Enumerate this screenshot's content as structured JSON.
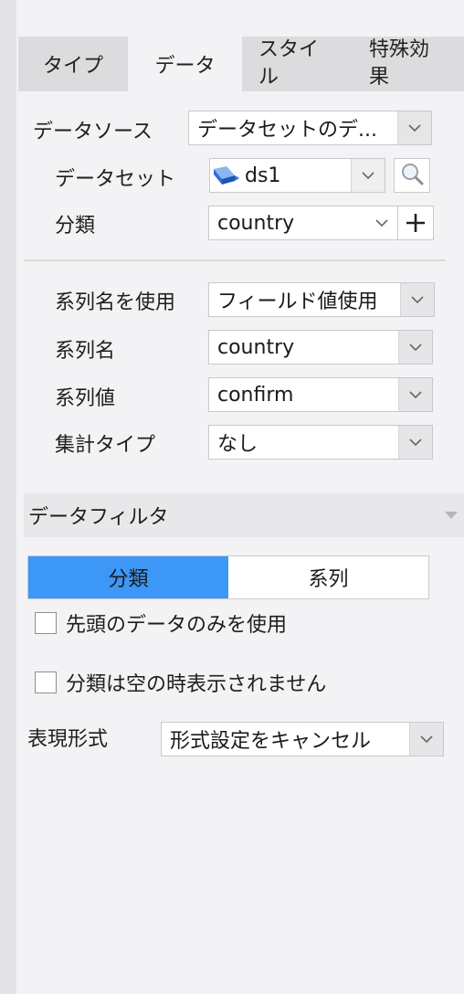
{
  "tabs": [
    {
      "label": "タイプ",
      "active": false
    },
    {
      "label": "データ",
      "active": true
    },
    {
      "label": "スタイル",
      "active": false
    },
    {
      "label": "特殊効果",
      "active": false
    }
  ],
  "datasource": {
    "label": "データソース",
    "value": "データセットのデ..."
  },
  "dataset": {
    "label": "データセット",
    "value": "ds1"
  },
  "category": {
    "label": "分類",
    "value": "country"
  },
  "series_name_mode": {
    "label": "系列名を使用",
    "value": "フィールド値使用"
  },
  "series_name": {
    "label": "系列名",
    "value": "country"
  },
  "series_value": {
    "label": "系列値",
    "value": "confirm"
  },
  "aggregate": {
    "label": "集計タイプ",
    "value": "なし"
  },
  "data_filter": {
    "title": "データフィルタ"
  },
  "filter_segment": {
    "options": [
      "分類",
      "系列"
    ],
    "selected": "分類"
  },
  "checkboxes": [
    {
      "label": "先頭のデータのみを使用",
      "checked": false
    },
    {
      "label": "分類は空の時表示されません",
      "checked": false
    }
  ],
  "format": {
    "label": "表現形式",
    "value": "形式設定をキャンセル"
  },
  "colors": {
    "accent": "#3d97f6",
    "dataset_icon": "#2f6fd6"
  }
}
